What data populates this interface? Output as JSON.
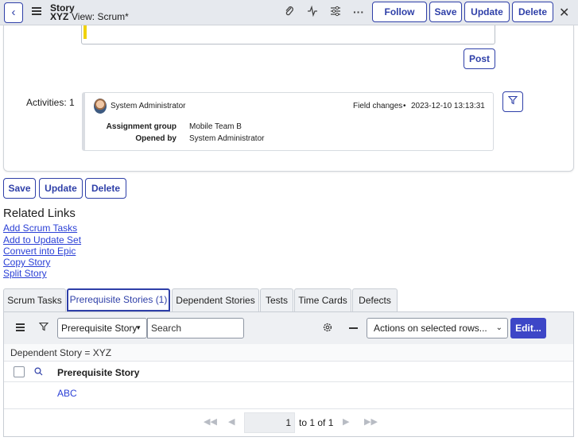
{
  "header": {
    "record_type": "Story",
    "record_name": "XYZ",
    "view_label": "View: Scrum*",
    "buttons": {
      "follow": "Follow",
      "save": "Save",
      "update": "Update",
      "delete": "Delete"
    },
    "icons": [
      "back-icon",
      "menu-icon",
      "attachment-icon",
      "activity-icon",
      "settings-sliders-icon",
      "more-icon",
      "close-icon"
    ]
  },
  "form": {
    "post_label": "Post",
    "activities_label": "Activities: 1",
    "activity": {
      "author": "System Administrator",
      "type": "Field changes",
      "timestamp": "2023-12-10 13:13:31",
      "fields": [
        {
          "label": "Assignment group",
          "value": "Mobile Team B"
        },
        {
          "label": "Opened by",
          "value": "System Administrator"
        }
      ]
    }
  },
  "bottom_buttons": {
    "save": "Save",
    "update": "Update",
    "delete": "Delete"
  },
  "related_links": {
    "title": "Related Links",
    "links": [
      "Add Scrum Tasks",
      "Add to Update Set",
      "Convert into Epic",
      "Copy Story",
      "Split Story"
    ]
  },
  "tabs": [
    {
      "label": "Scrum Tasks",
      "active": false
    },
    {
      "label": "Prerequisite Stories (1)",
      "active": true
    },
    {
      "label": "Dependent Stories",
      "active": false
    },
    {
      "label": "Tests",
      "active": false
    },
    {
      "label": "Time Cards",
      "active": false
    },
    {
      "label": "Defects",
      "active": false
    }
  ],
  "list": {
    "search_field": "Prerequisite Story",
    "search_placeholder": "Search",
    "actions_label": "Actions on selected rows...",
    "edit_label": "Edit...",
    "breadcrumb": "Dependent Story = XYZ",
    "column_header": "Prerequisite Story",
    "rows": [
      "ABC"
    ],
    "pager": {
      "current": "1",
      "range_text": "to 1 of 1"
    }
  },
  "colors": {
    "accent": "#2e3fa8",
    "link": "#2a3fd6",
    "primary_button": "#3d46c7",
    "header_bg": "#e6e9ee"
  }
}
